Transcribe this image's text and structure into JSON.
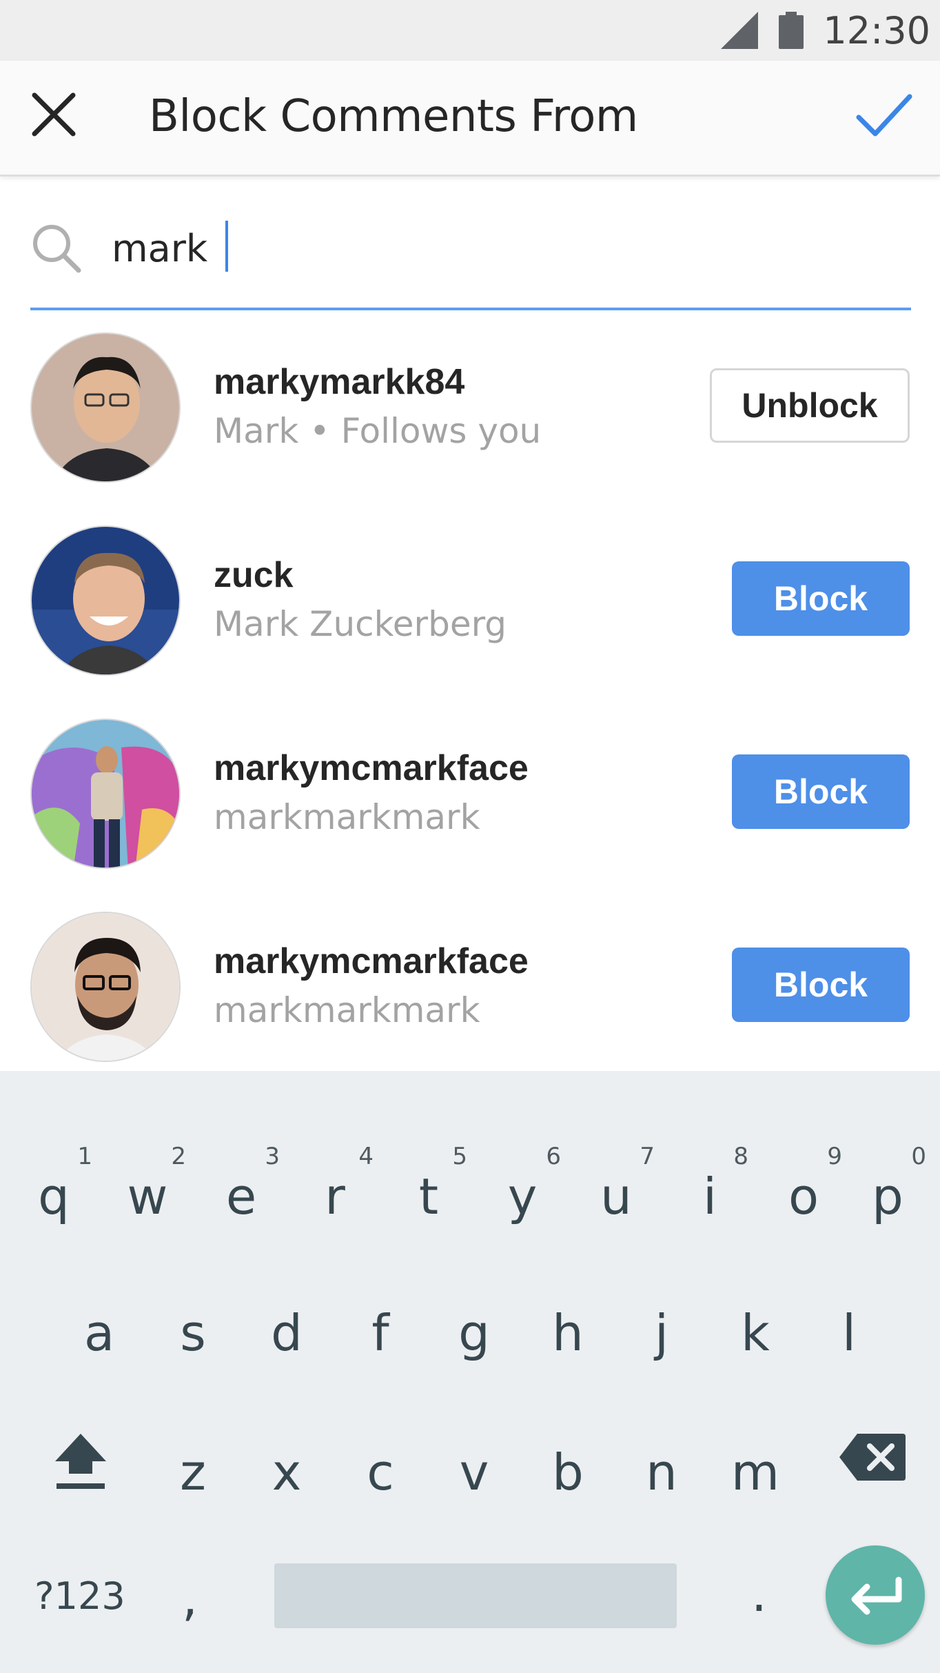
{
  "status_bar": {
    "time": "12:30"
  },
  "app_bar": {
    "title": "Block Comments From"
  },
  "search": {
    "value": "mark",
    "placeholder": ""
  },
  "results": [
    {
      "username": "markymarkk84",
      "subtitle": "Mark • Follows you",
      "action": "Unblock",
      "avatar_bg": "#b79a88"
    },
    {
      "username": "zuck",
      "subtitle": "Mark Zuckerberg",
      "action": "Block",
      "avatar_bg": "#1f3e80"
    },
    {
      "username": "markymcmarkface",
      "subtitle": "markmarkmark",
      "action": "Block",
      "avatar_bg": "#6fa8c8"
    },
    {
      "username": "markymcmarkface",
      "subtitle": "markmarkmark",
      "action": "Block",
      "avatar_bg": "#e9d6cc"
    }
  ],
  "keyboard": {
    "row1": [
      {
        "char": "q",
        "hint": "1"
      },
      {
        "char": "w",
        "hint": "2"
      },
      {
        "char": "e",
        "hint": "3"
      },
      {
        "char": "r",
        "hint": "4"
      },
      {
        "char": "t",
        "hint": "5"
      },
      {
        "char": "y",
        "hint": "6"
      },
      {
        "char": "u",
        "hint": "7"
      },
      {
        "char": "i",
        "hint": "8"
      },
      {
        "char": "o",
        "hint": "9"
      },
      {
        "char": "p",
        "hint": "0"
      }
    ],
    "row2": [
      "a",
      "s",
      "d",
      "f",
      "g",
      "h",
      "j",
      "k",
      "l"
    ],
    "row3": [
      "z",
      "x",
      "c",
      "v",
      "b",
      "n",
      "m"
    ],
    "symbols_label": "?123",
    "comma": ",",
    "period": "."
  },
  "colors": {
    "accent": "#3a86e8",
    "block_button": "#4e8fe8",
    "enter_key": "#5fb5a8",
    "keyboard_bg": "#eceff1"
  },
  "icons": {
    "close": "close-icon",
    "done": "check-icon",
    "search": "search-icon",
    "shift": "shift-icon",
    "backspace": "backspace-icon",
    "enter": "enter-icon"
  }
}
